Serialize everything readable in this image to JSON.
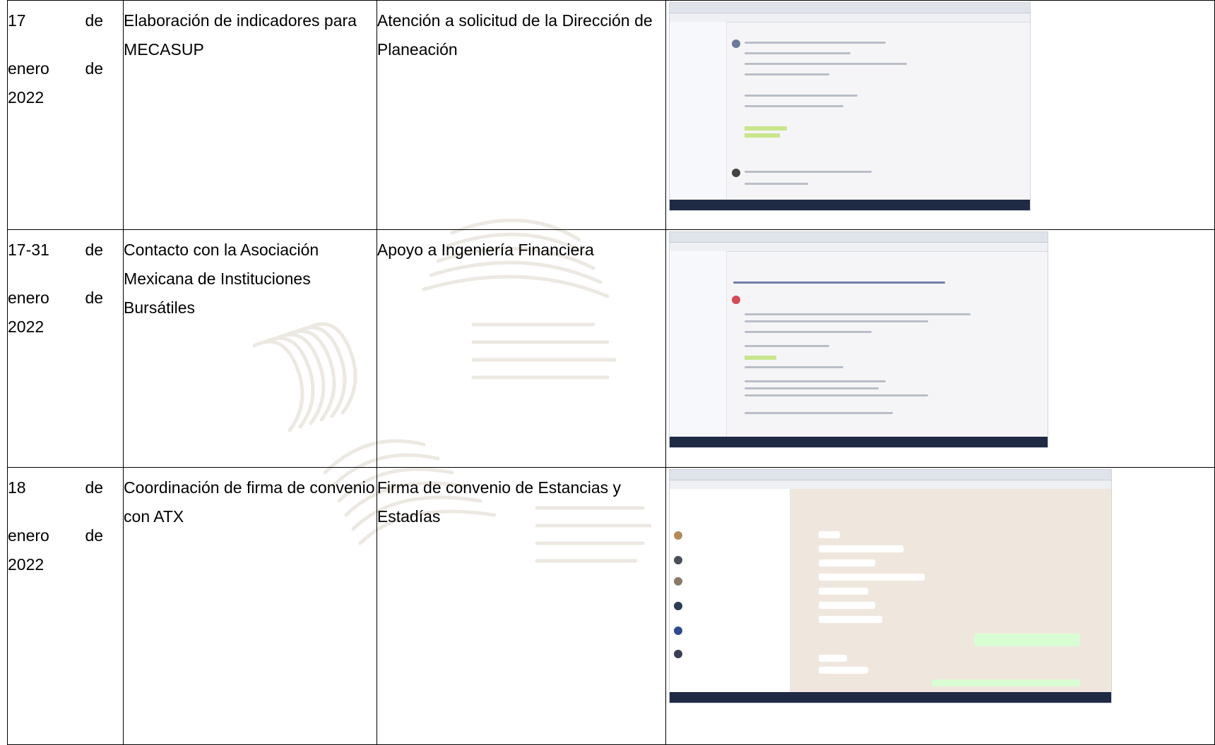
{
  "rows": [
    {
      "date": {
        "day": "17",
        "de1": "de",
        "month": "enero",
        "de2": "de",
        "year": "2022"
      },
      "activity": "Elaboración de indicadores para MECASUP",
      "purpose": "Atención a solicitud de la Dirección de Planeación",
      "evidence_icon": "gmail-email-screenshot"
    },
    {
      "date": {
        "day": "17-31",
        "de1": "de",
        "month": "enero",
        "de2": "de",
        "year": "2022"
      },
      "activity": "Contacto con la Asociación Mexicana de Instituciones Bursátiles",
      "purpose": "Apoyo a Ingeniería Financiera",
      "evidence_icon": "gmail-email-screenshot"
    },
    {
      "date": {
        "day": "18",
        "de1": "de",
        "month": "enero",
        "de2": "de",
        "year": "2022"
      },
      "activity": "Coordinación de firma de convenio con ATX",
      "purpose": "Firma de convenio de Estancias y Estadías",
      "evidence_icon": "whatsapp-chat-screenshot"
    }
  ]
}
